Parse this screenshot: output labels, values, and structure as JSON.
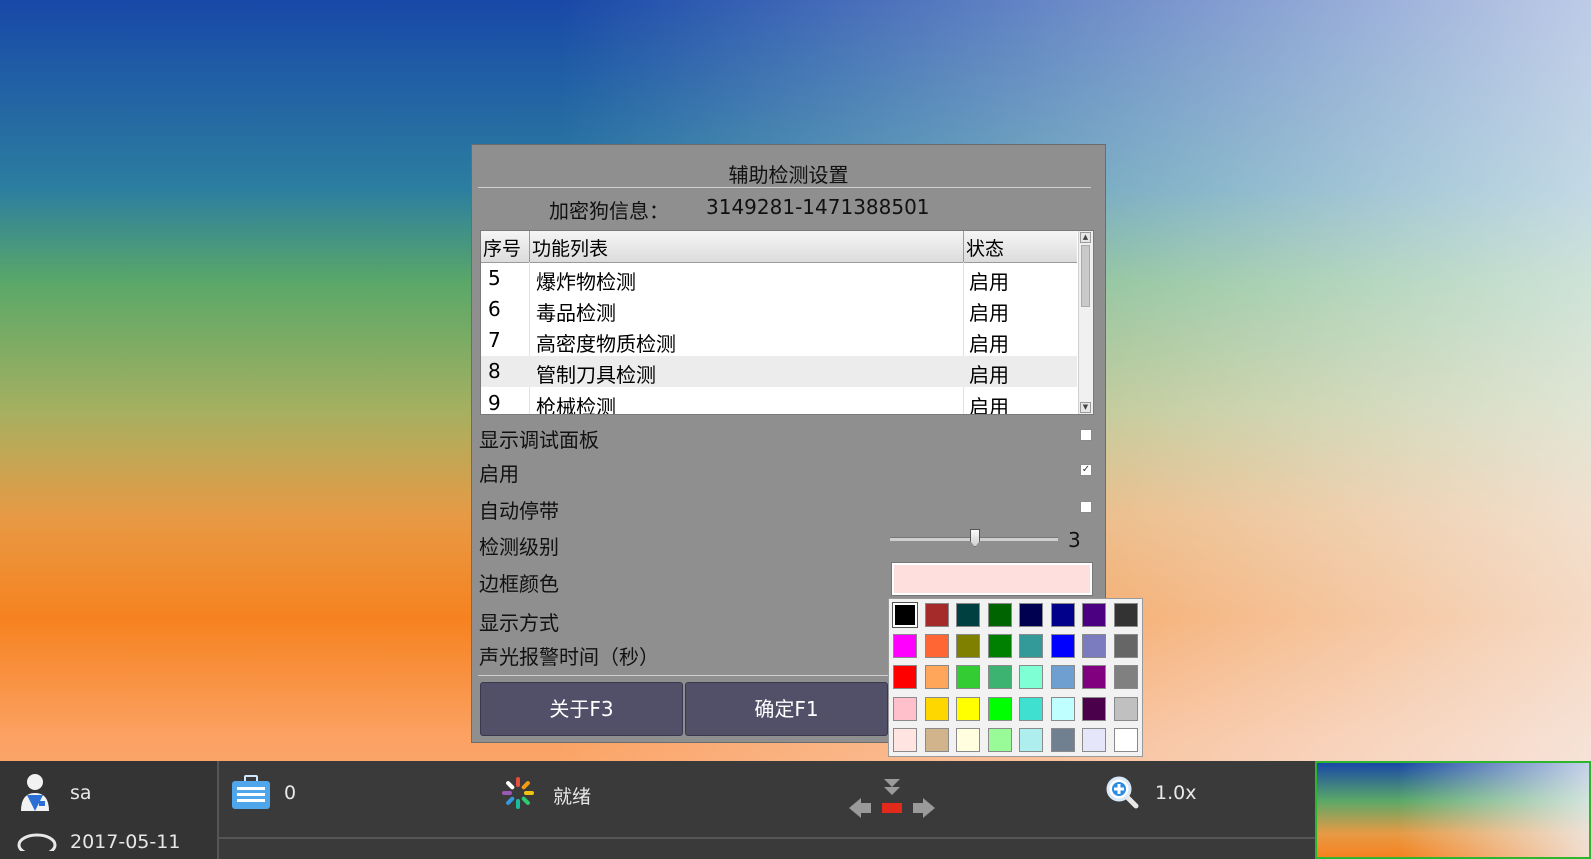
{
  "dialog": {
    "title": "辅助检测设置",
    "dongle_label": "加密狗信息：",
    "dongle_value": "3149281-1471388501",
    "table": {
      "headers": [
        "序号",
        "功能列表",
        "状态"
      ],
      "rows": [
        {
          "no": "5",
          "name": "爆炸物检测",
          "status": "启用"
        },
        {
          "no": "6",
          "name": "毒品检测",
          "status": "启用"
        },
        {
          "no": "7",
          "name": "高密度物质检测",
          "status": "启用"
        },
        {
          "no": "8",
          "name": "管制刀具检测",
          "status": "启用"
        },
        {
          "no": "9",
          "name": "枪械检测",
          "status": "启用"
        }
      ]
    },
    "options": {
      "show_debug_panel": {
        "label": "显示调试面板",
        "checked": false
      },
      "enable": {
        "label": "启用",
        "checked": true
      },
      "auto_stop_belt": {
        "label": "自动停带",
        "checked": false
      },
      "detect_level": {
        "label": "检测级别",
        "value": "3"
      },
      "border_color": {
        "label": "边框颜色",
        "value": "#ffdede"
      },
      "display_mode": {
        "label": "显示方式"
      },
      "alarm_time": {
        "label": "声光报警时间（秒）"
      }
    },
    "buttons": {
      "about": "关于F3",
      "ok": "确定F1"
    }
  },
  "palette": {
    "colors": [
      "#000000",
      "#a52a2a",
      "#004040",
      "#006400",
      "#000050",
      "#00008b",
      "#4b0082",
      "#333333",
      "#ff00ff",
      "#ff6633",
      "#808000",
      "#008000",
      "#339999",
      "#0000ff",
      "#7b7bc0",
      "#666666",
      "#ff0000",
      "#ffa65a",
      "#33cc33",
      "#3cb371",
      "#7fffd4",
      "#6f9fd0",
      "#800080",
      "#808080",
      "#ffc0cb",
      "#ffd700",
      "#ffff00",
      "#00ff00",
      "#40e0d0",
      "#bfffff",
      "#4b004b",
      "#c0c0c0",
      "#ffe4e1",
      "#d2b48c",
      "#ffffe0",
      "#98fb98",
      "#afeeee",
      "#708090",
      "#e6e6fa",
      "#ffffff"
    ],
    "selected_index": 0
  },
  "taskbar": {
    "user": "sa",
    "date": "2017-05-11",
    "count": "0",
    "status": "就绪",
    "zoom": "1.0x"
  }
}
